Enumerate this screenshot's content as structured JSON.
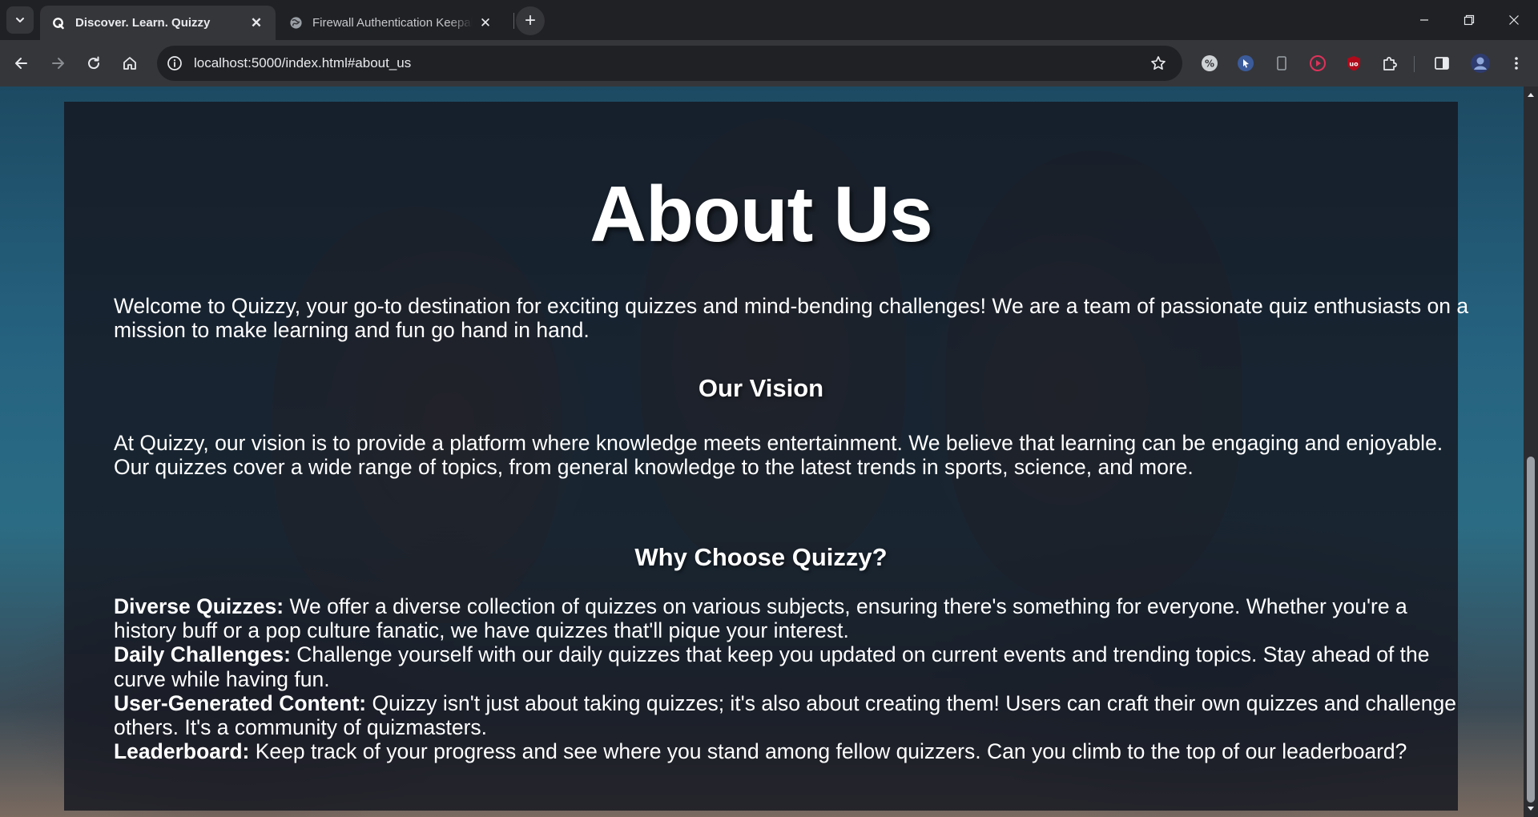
{
  "browser": {
    "tabs": [
      {
        "title": "Discover. Learn. Quizzy",
        "favicon": "quizzy-q-icon",
        "active": true
      },
      {
        "title": "Firewall Authentication Keepalive",
        "favicon": "globe-icon",
        "active": false
      }
    ],
    "url": "localhost:5000/index.html#about_us"
  },
  "page": {
    "title": "About Us",
    "intro": "Welcome to Quizzy, your go-to destination for exciting quizzes and mind-bending challenges! We are a team of passionate quiz enthusiasts on a mission to make learning and fun go hand in hand.",
    "vision_heading": "Our Vision",
    "vision_text": "At Quizzy, our vision is to provide a platform where knowledge meets entertainment. We believe that learning can be engaging and enjoyable. Our quizzes cover a wide range of topics, from general knowledge to the latest trends in sports, science, and more.",
    "why_heading": "Why Choose Quizzy?",
    "features": [
      {
        "label": "Diverse Quizzes:",
        "text": " We offer a diverse collection of quizzes on various subjects, ensuring there's something for everyone. Whether you're a history buff or a pop culture fanatic, we have quizzes that'll pique your interest."
      },
      {
        "label": "Daily Challenges:",
        "text": " Challenge yourself with our daily quizzes that keep you updated on current events and trending topics. Stay ahead of the curve while having fun."
      },
      {
        "label": "User-Generated Content:",
        "text": " Quizzy isn't just about taking quizzes; it's also about creating them! Users can craft their own quizzes and challenge others. It's a community of quizmasters."
      },
      {
        "label": "Leaderboard:",
        "text": " Keep track of your progress and see where you stand among fellow quizzers. Can you climb to the top of our leaderboard?"
      }
    ]
  },
  "scroll": {
    "position_fraction": 0.5
  }
}
